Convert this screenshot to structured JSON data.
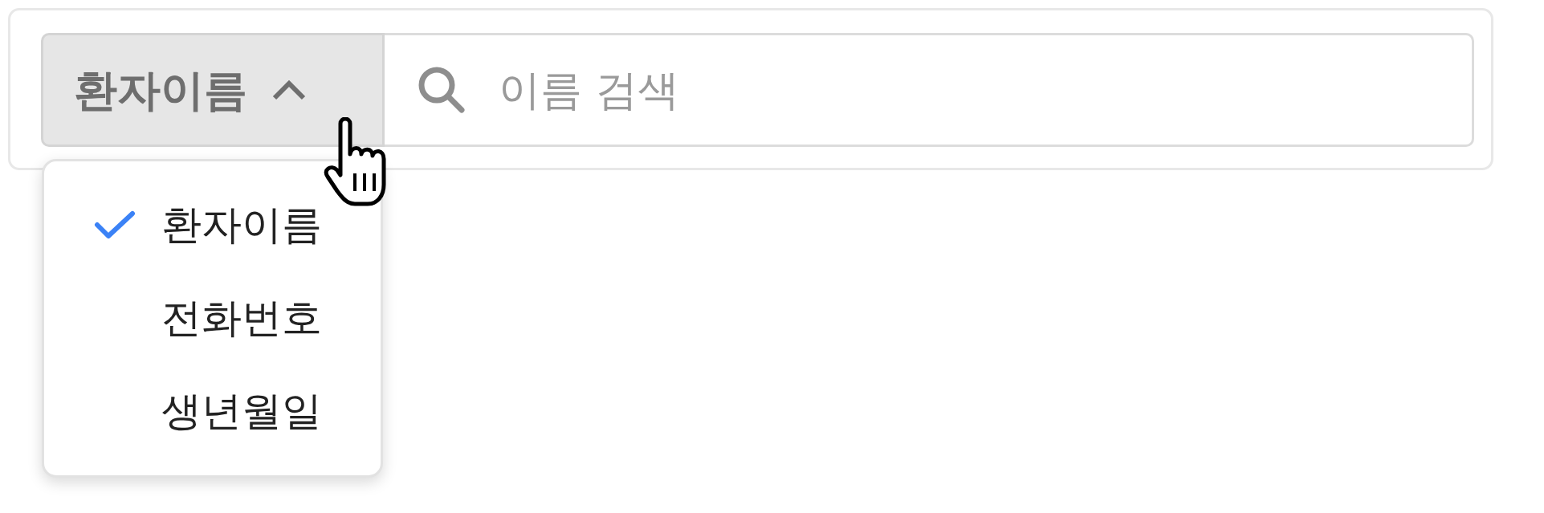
{
  "search": {
    "filter_label": "환자이름",
    "expanded": true,
    "placeholder": "이름 검색"
  },
  "menu": {
    "items": [
      {
        "label": "환자이름",
        "selected": true
      },
      {
        "label": "전화번호",
        "selected": false
      },
      {
        "label": "생년월일",
        "selected": false
      }
    ]
  }
}
